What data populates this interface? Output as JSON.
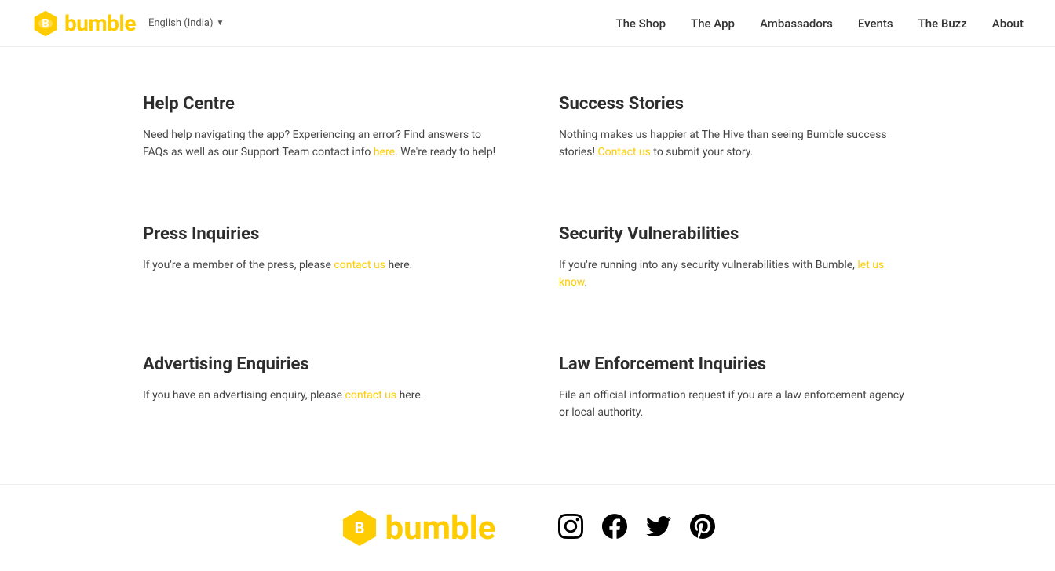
{
  "header": {
    "logo_text": "bumble",
    "lang_label": "English (India)",
    "nav": {
      "shop": "The Shop",
      "app": "The App",
      "ambassadors": "Ambassadors",
      "events": "Events",
      "buzz": "The Buzz",
      "about": "About"
    }
  },
  "main": {
    "cards": [
      {
        "id": "help-centre",
        "title": "Help Centre",
        "text_before": "Need help navigating the app? Experiencing an error? Find answers to FAQs as well as our Support Team contact info ",
        "link1_text": "here",
        "text_after": ". We're ready to help!",
        "link2_text": "",
        "text_middle": ""
      },
      {
        "id": "success-stories",
        "title": "Success Stories",
        "text_before": "Nothing makes us happier at The Hive than seeing Bumble success stories! ",
        "link1_text": "Contact us",
        "text_after": " to submit your story.",
        "link2_text": "",
        "text_middle": ""
      },
      {
        "id": "press-inquiries",
        "title": "Press Inquiries",
        "text_before": "If you're a member of the press, please ",
        "link1_text": "contact us",
        "text_after": " here.",
        "link2_text": "",
        "text_middle": ""
      },
      {
        "id": "security-vulnerabilities",
        "title": "Security Vulnerabilities",
        "text_before": "If you're running into any security vulnerabilities with Bumble, ",
        "link1_text": "let us know",
        "text_after": ".",
        "link2_text": "",
        "text_middle": ""
      },
      {
        "id": "advertising-enquiries",
        "title": "Advertising Enquiries",
        "text_before": "If you have an advertising enquiry, please ",
        "link1_text": "contact us",
        "text_after": " here.",
        "link2_text": "",
        "text_middle": ""
      },
      {
        "id": "law-enforcement-inquiries",
        "title": "Law Enforcement Inquiries",
        "text_before": "File an official information request if you are a law enforcement agency or local authority.",
        "link1_text": "",
        "text_after": "",
        "link2_text": "",
        "text_middle": ""
      }
    ]
  },
  "footer": {
    "logo_text": "bumble",
    "social": {
      "instagram": "Instagram",
      "facebook": "Facebook",
      "twitter": "Twitter",
      "pinterest": "Pinterest"
    }
  }
}
